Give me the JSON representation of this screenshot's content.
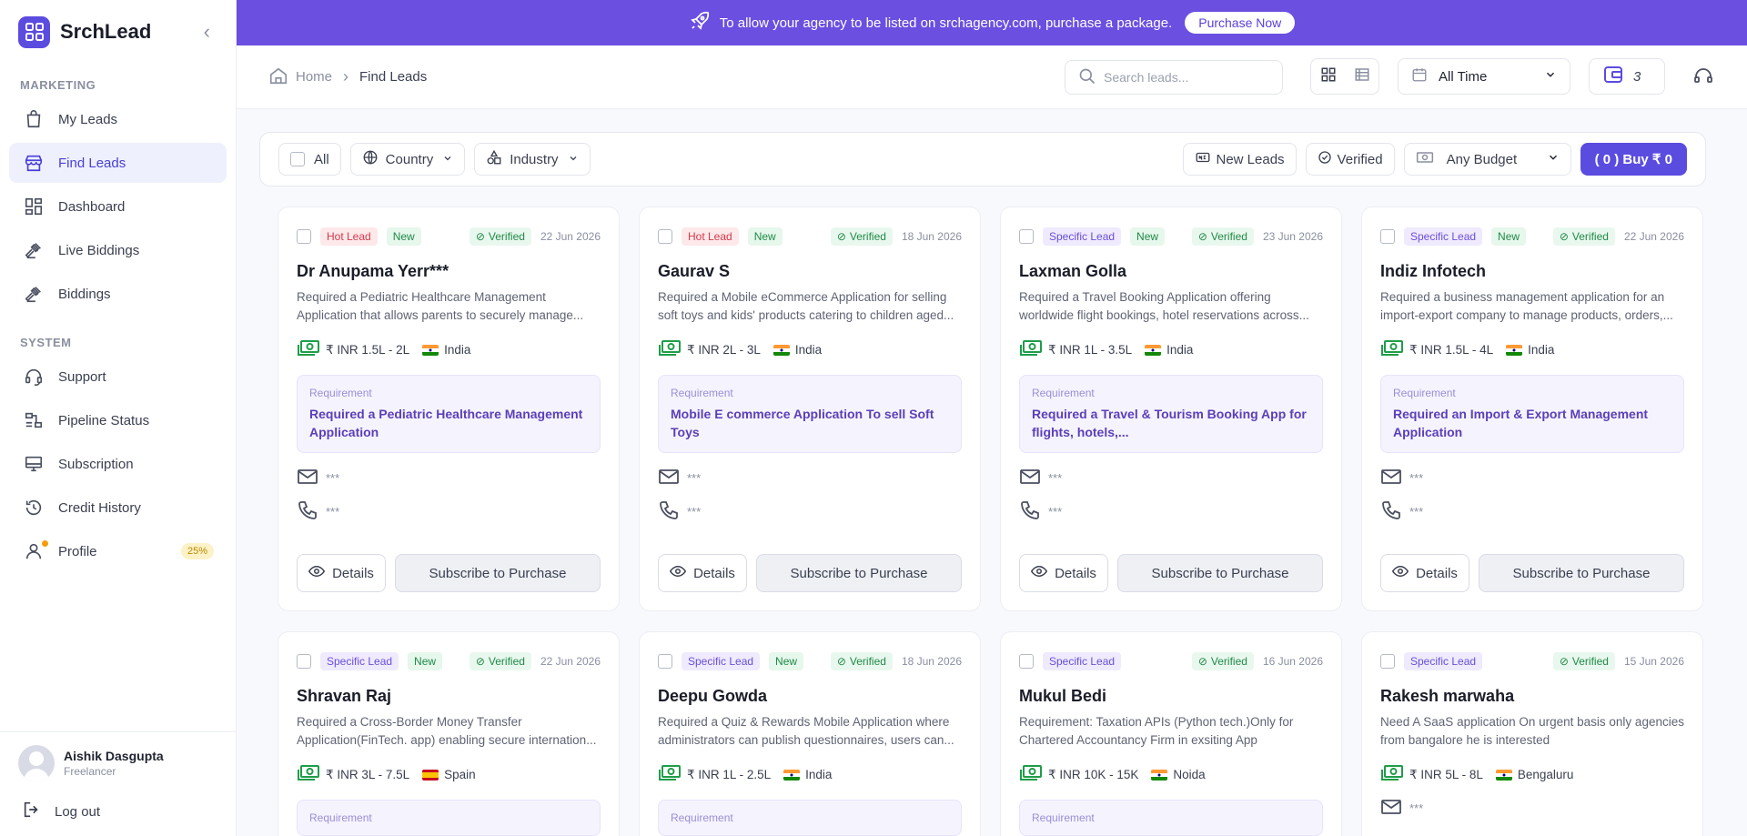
{
  "app": {
    "name": "SrchLead"
  },
  "banner": {
    "text": "To allow your agency to be listed on srchagency.com, purchase a package.",
    "button": "Purchase Now"
  },
  "sidebar": {
    "section_marketing": "MARKETING",
    "section_system": "SYSTEM",
    "items": [
      {
        "label": "My Leads"
      },
      {
        "label": "Find Leads"
      },
      {
        "label": "Dashboard"
      },
      {
        "label": "Live Biddings"
      },
      {
        "label": "Biddings"
      },
      {
        "label": "Support"
      },
      {
        "label": "Pipeline Status"
      },
      {
        "label": "Subscription"
      },
      {
        "label": "Credit History"
      },
      {
        "label": "Profile",
        "badge": "25%"
      }
    ],
    "user": {
      "name": "Aishik Dasgupta",
      "role": "Freelancer"
    },
    "logout": "Log out"
  },
  "topbar": {
    "breadcrumb_home": "Home",
    "breadcrumb_current": "Find Leads",
    "search_placeholder": "Search leads...",
    "date_filter": "All Time",
    "wallet_count": "3"
  },
  "filters": {
    "all": "All",
    "country": "Country",
    "industry": "Industry",
    "new_leads": "New Leads",
    "verified": "Verified",
    "budget": "Any Budget",
    "buy": "( 0 ) Buy ₹ 0"
  },
  "card_labels": {
    "requirement": "Requirement",
    "details": "Details",
    "subscribe": "Subscribe to Purchase",
    "verified": "Verified",
    "new": "New",
    "hidden": "***"
  },
  "leads": [
    {
      "type": "Hot Lead",
      "is_new": true,
      "date": "22 Jun 2026",
      "name": "Dr Anupama Yerr***",
      "desc": "Required a Pediatric Healthcare Management Application that allows parents to securely manage...",
      "budget": "₹ INR 1.5L - 2L",
      "location": "India",
      "requirement": "Required a Pediatric Healthcare Management Application"
    },
    {
      "type": "Hot Lead",
      "is_new": true,
      "date": "18 Jun 2026",
      "name": "Gaurav S",
      "desc": "Required a Mobile eCommerce Application for selling soft toys and kids' products catering to children aged...",
      "budget": "₹ INR 2L - 3L",
      "location": "India",
      "requirement": "Mobile E commerce Application To sell Soft Toys"
    },
    {
      "type": "Specific Lead",
      "is_new": true,
      "date": "23 Jun 2026",
      "name": "Laxman Golla",
      "desc": "Required a Travel Booking Application offering worldwide flight bookings, hotel reservations across...",
      "budget": "₹ INR 1L - 3.5L",
      "location": "India",
      "requirement": "Required a Travel & Tourism Booking App for flights, hotels,..."
    },
    {
      "type": "Specific Lead",
      "is_new": true,
      "date": "22 Jun 2026",
      "name": "Indiz Infotech",
      "desc": "Required a business management application for an import-export company to manage products, orders,...",
      "budget": "₹ INR 1.5L - 4L",
      "location": "India",
      "requirement": "Required an Import & Export Management Application"
    },
    {
      "type": "Specific Lead",
      "is_new": true,
      "date": "22 Jun 2026",
      "name": "Shravan Raj",
      "desc": "Required a Cross-Border Money Transfer Application(FinTech. app) enabling secure internation...",
      "budget": "₹ INR 3L - 7.5L",
      "location": "Spain",
      "requirement": ""
    },
    {
      "type": "Specific Lead",
      "is_new": true,
      "date": "18 Jun 2026",
      "name": "Deepu Gowda",
      "desc": "Required a Quiz & Rewards Mobile Application where administrators can publish questionnaires, users can...",
      "budget": "₹ INR 1L - 2.5L",
      "location": "India",
      "requirement": ""
    },
    {
      "type": "Specific Lead",
      "is_new": false,
      "date": "16 Jun 2026",
      "name": "Mukul Bedi",
      "desc": "Requirement: Taxation APIs (Python tech.)Only for Chartered Accountancy Firm in exsiting App",
      "budget": "₹ INR 10K - 15K",
      "location": "Noida",
      "requirement": ""
    },
    {
      "type": "Specific Lead",
      "is_new": false,
      "date": "15 Jun 2026",
      "name": "Rakesh marwaha",
      "desc": "Need A SaaS application On urgent basis only agencies from bangalore he is interested",
      "budget": "₹ INR 5L - 8L",
      "location": "Bengaluru",
      "requirement": ""
    }
  ]
}
